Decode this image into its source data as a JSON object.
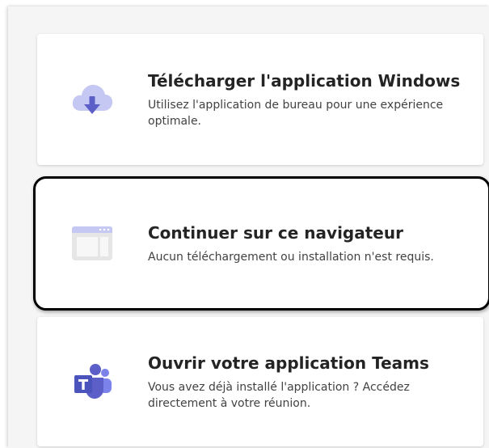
{
  "options": [
    {
      "title": "Télécharger l'application Windows",
      "description": "Utilisez l'application de bureau pour une expérience optimale.",
      "icon": "cloud-download-icon"
    },
    {
      "title": "Continuer sur ce navigateur",
      "description": "Aucun téléchargement ou installation n'est requis.",
      "icon": "browser-window-icon",
      "selected": true
    },
    {
      "title": "Ouvrir votre application Teams",
      "description": "Vous avez déjà installé l'application ? Accédez directement à votre réunion.",
      "icon": "teams-logo-icon"
    }
  ],
  "colors": {
    "accent": "#5b5fc7",
    "accent_light": "#c5c8f2",
    "browser_gray": "#d6d6d6",
    "highlight_border": "#000000"
  }
}
